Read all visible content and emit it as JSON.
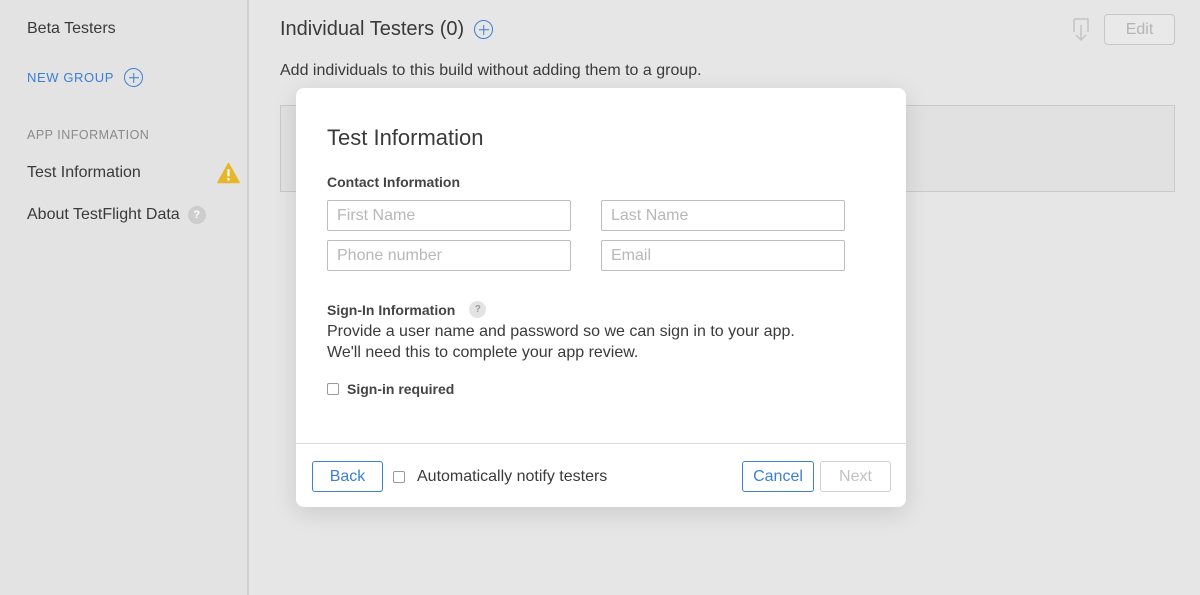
{
  "sidebar": {
    "beta_testers": "Beta Testers",
    "new_group": "NEW GROUP",
    "app_information_header": "APP INFORMATION",
    "test_information": "Test Information",
    "about_testflight": "About TestFlight Data",
    "help_glyph": "?"
  },
  "main": {
    "title": "Individual Testers (0)",
    "subtitle": "Add individuals to this build without adding them to a group.",
    "edit_button": "Edit"
  },
  "modal": {
    "title": "Test Information",
    "contact_label": "Contact Information",
    "fields": {
      "first_name_placeholder": "First Name",
      "last_name_placeholder": "Last Name",
      "phone_placeholder": "Phone number",
      "email_placeholder": "Email"
    },
    "signin_label": "Sign-In Information",
    "signin_help": "?",
    "signin_description": "Provide a user name and password so we can sign in to your app. We'll need this to complete your app review.",
    "signin_required": "Sign-in required",
    "signin_required_checked": false,
    "footer": {
      "back": "Back",
      "auto_notify": "Automatically notify testers",
      "auto_notify_checked": false,
      "cancel": "Cancel",
      "next": "Next"
    }
  },
  "colors": {
    "accent": "#3c7fd3",
    "warning": "#e8b52a",
    "background": "#e6e6e6",
    "modal_bg": "#ffffff"
  },
  "icons": {
    "add": "plus-circle-icon",
    "warning": "warning-triangle-icon",
    "help": "question-circle-icon",
    "download": "download-icon"
  }
}
